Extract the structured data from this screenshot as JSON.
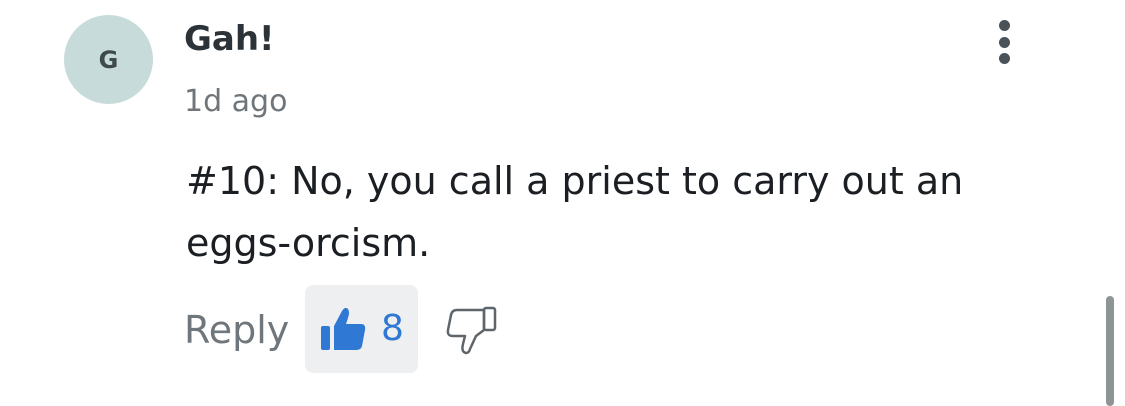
{
  "comment": {
    "avatar_initial": "G",
    "author": "Gah!",
    "timestamp": "1d ago",
    "text": "#10: No, you call a priest to carry out an eggs-orcism.",
    "actions": {
      "reply_label": "Reply",
      "like_count": "8",
      "like_icon": "thumbs-up-icon",
      "dislike_icon": "thumbs-down-icon",
      "more_icon": "more-vertical-icon"
    }
  },
  "colors": {
    "avatar_bg": "#c7dbdb",
    "like_active": "#2f78d3",
    "like_bg": "#eeeff1"
  }
}
